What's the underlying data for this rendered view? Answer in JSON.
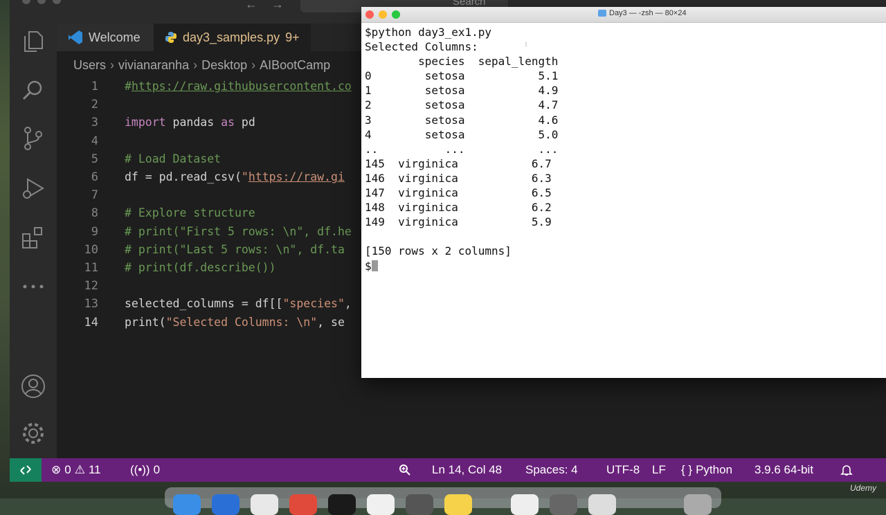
{
  "vscode": {
    "search_label": "Search",
    "tabs": [
      {
        "label": "Welcome"
      },
      {
        "label": "day3_samples.py",
        "badge": "9+"
      }
    ],
    "breadcrumb": [
      "Users",
      "vivianaranha",
      "Desktop",
      "AIBootCamp"
    ],
    "code_lines": [
      {
        "num": "1",
        "parts": [
          {
            "t": "#",
            "c": "cm"
          },
          {
            "t": "https://raw.githubusercontent.co",
            "c": "cm-url"
          }
        ]
      },
      {
        "num": "2",
        "parts": []
      },
      {
        "num": "3",
        "parts": [
          {
            "t": "import",
            "c": "kw"
          },
          {
            "t": " pandas ",
            "c": "plain"
          },
          {
            "t": "as",
            "c": "kw"
          },
          {
            "t": " pd",
            "c": "plain"
          }
        ]
      },
      {
        "num": "4",
        "parts": []
      },
      {
        "num": "5",
        "parts": [
          {
            "t": "# Load Dataset",
            "c": "cm"
          }
        ]
      },
      {
        "num": "6",
        "parts": [
          {
            "t": "df = pd.read_csv(",
            "c": "plain"
          },
          {
            "t": "\"",
            "c": "str"
          },
          {
            "t": "https://raw.gi",
            "c": "url"
          }
        ]
      },
      {
        "num": "7",
        "parts": []
      },
      {
        "num": "8",
        "parts": [
          {
            "t": "# Explore structure",
            "c": "cm"
          }
        ]
      },
      {
        "num": "9",
        "parts": [
          {
            "t": "# print(\"First 5 rows: \\n\", df.he",
            "c": "cm"
          }
        ]
      },
      {
        "num": "10",
        "parts": [
          {
            "t": "# print(\"Last 5 rows: \\n\", df.ta",
            "c": "cm"
          }
        ]
      },
      {
        "num": "11",
        "parts": [
          {
            "t": "# print(df.describe())",
            "c": "cm"
          }
        ]
      },
      {
        "num": "12",
        "parts": []
      },
      {
        "num": "13",
        "parts": [
          {
            "t": "selected_columns = df[[",
            "c": "plain"
          },
          {
            "t": "\"species\"",
            "c": "str"
          },
          {
            "t": ",",
            "c": "plain"
          }
        ]
      },
      {
        "num": "14",
        "active": true,
        "parts": [
          {
            "t": "print(",
            "c": "plain"
          },
          {
            "t": "\"Selected Columns: \\n\"",
            "c": "str"
          },
          {
            "t": ", se",
            "c": "plain"
          }
        ]
      }
    ]
  },
  "statusbar": {
    "errors": "0",
    "warnings": "11",
    "ports": "0",
    "position": "Ln 14, Col 48",
    "spaces": "Spaces: 4",
    "encoding": "UTF-8",
    "eol": "LF",
    "language_braces": "{ }",
    "language": "Python",
    "interpreter": "3.9.6 64-bit"
  },
  "terminal": {
    "title": "Day3 — -zsh — 80×24",
    "lines": [
      "$python day3_ex1.py",
      "Selected Columns:",
      "        species  sepal_length",
      "0        setosa           5.1",
      "1        setosa           4.9",
      "2        setosa           4.7",
      "3        setosa           4.6",
      "4        setosa           5.0",
      "..          ...           ...",
      "145  virginica           6.7",
      "146  virginica           6.3",
      "147  virginica           6.5",
      "148  virginica           6.2",
      "149  virginica           5.9",
      "",
      "[150 rows x 2 columns]"
    ],
    "prompt": "$"
  },
  "watermark": "Udemy",
  "colors": {
    "statusbar": "#68217a",
    "remote": "#16825d",
    "editor_bg": "#1e1e1e"
  }
}
